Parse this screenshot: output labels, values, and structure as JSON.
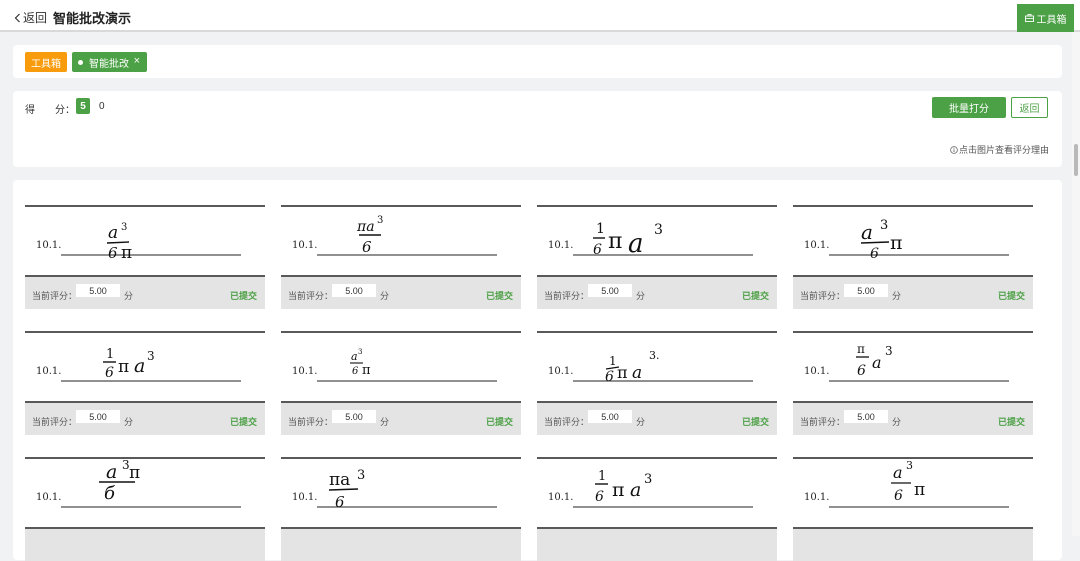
{
  "header": {
    "back_label": "返回",
    "title": "智能批改演示",
    "toolbox_label": "工具箱"
  },
  "tags": {
    "toolbox": "工具箱",
    "active": "智能批改",
    "close": "×"
  },
  "score": {
    "label_a": "得",
    "label_b": "分：",
    "value": "5",
    "zero": "0",
    "batch_label": "批量打分",
    "return_label": "返回",
    "hint": "点击图片查看评分理由"
  },
  "items": [
    {
      "label": "10.1.",
      "current_label": "当前评分：",
      "score": "5.00",
      "unit": "分",
      "status": "已提交"
    },
    {
      "label": "10.1.",
      "current_label": "当前评分：",
      "score": "5.00",
      "unit": "分",
      "status": "已提交"
    },
    {
      "label": "10.1.",
      "current_label": "当前评分：",
      "score": "5.00",
      "unit": "分",
      "status": "已提交"
    },
    {
      "label": "10.1.",
      "current_label": "当前评分：",
      "score": "5.00",
      "unit": "分",
      "status": "已提交"
    },
    {
      "label": "10.1.",
      "current_label": "当前评分：",
      "score": "5.00",
      "unit": "分",
      "status": "已提交"
    },
    {
      "label": "10.1.",
      "current_label": "当前评分：",
      "score": "5.00",
      "unit": "分",
      "status": "已提交"
    },
    {
      "label": "10.1.",
      "current_label": "当前评分：",
      "score": "5.00",
      "unit": "分",
      "status": "已提交"
    },
    {
      "label": "10.1.",
      "current_label": "当前评分：",
      "score": "5.00",
      "unit": "分",
      "status": "已提交"
    },
    {
      "label": "10.1."
    },
    {
      "label": "10.1."
    },
    {
      "label": "10.1."
    },
    {
      "label": "10.1."
    }
  ]
}
